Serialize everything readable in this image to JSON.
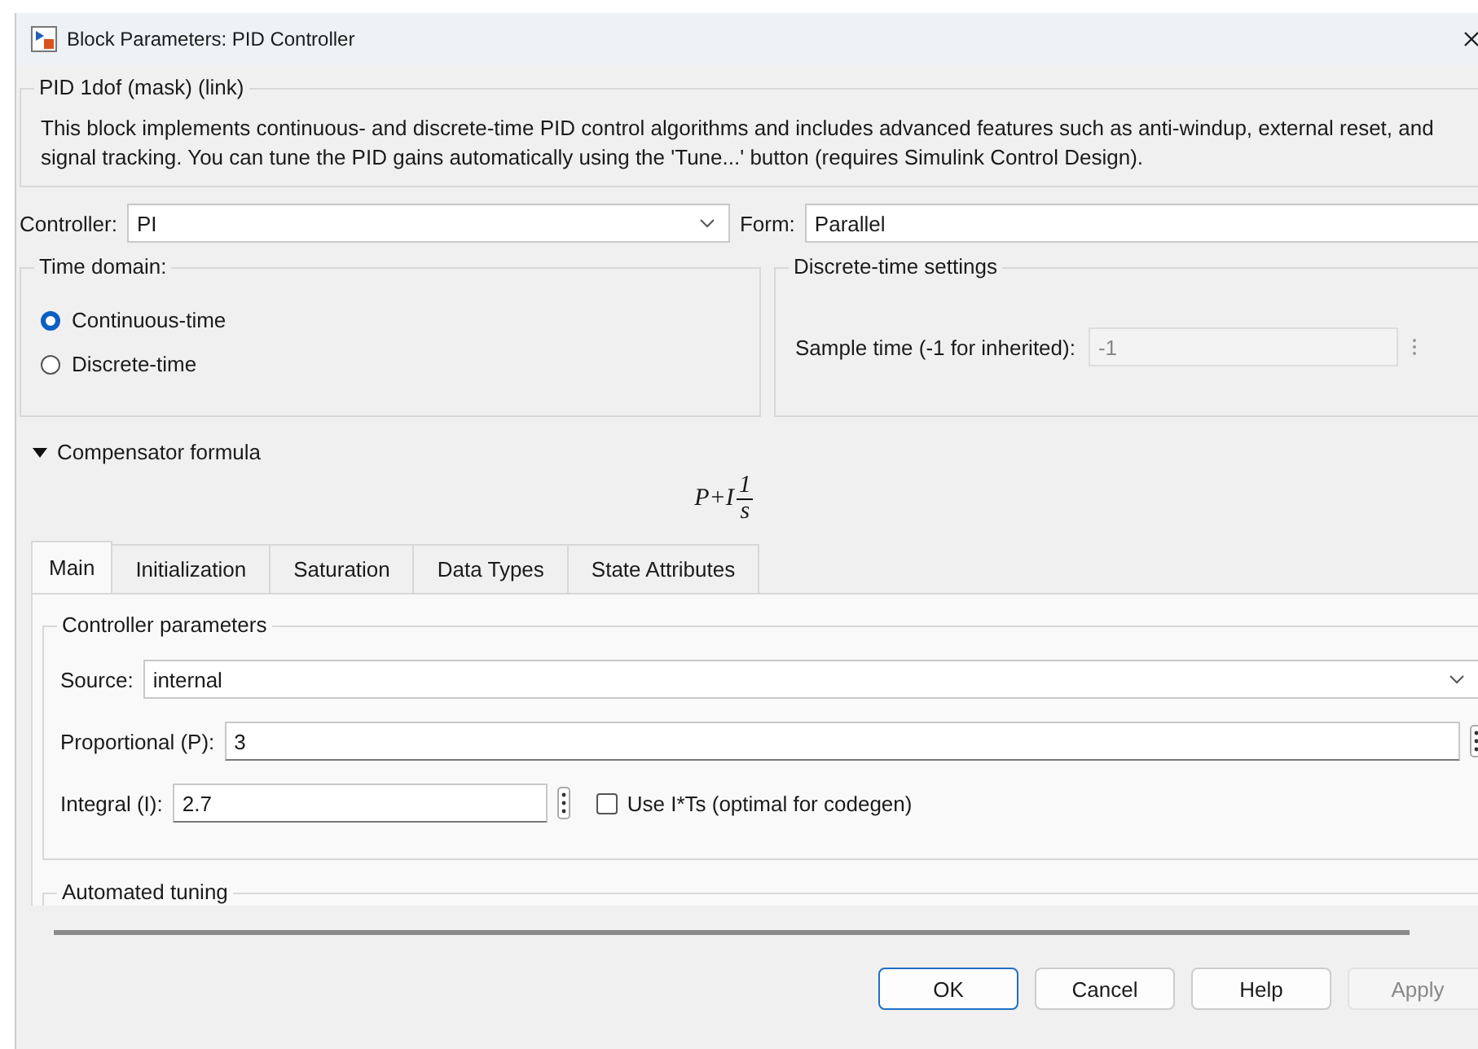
{
  "window": {
    "title": "Block Parameters: PID Controller"
  },
  "mask": {
    "legend": "PID 1dof (mask) (link)",
    "description": "This block implements continuous- and discrete-time PID control algorithms and includes advanced features such as anti-windup, external reset, and signal tracking. You can tune the PID gains automatically using the 'Tune...' button (requires Simulink Control Design)."
  },
  "controller": {
    "label": "Controller:",
    "value": "PI"
  },
  "form": {
    "label": "Form:",
    "value": "Parallel"
  },
  "time_domain": {
    "legend": "Time domain:",
    "options": [
      {
        "label": "Continuous-time",
        "selected": true
      },
      {
        "label": "Discrete-time",
        "selected": false
      }
    ]
  },
  "discrete_settings": {
    "legend": "Discrete-time settings",
    "label": "Sample time (-1 for inherited):",
    "value": "-1",
    "disabled": true
  },
  "compensator": {
    "label": "Compensator formula",
    "expanded": true,
    "formula": {
      "terms": "P+I",
      "numerator": "1",
      "denominator": "s"
    }
  },
  "tabs": [
    {
      "label": "Main",
      "selected": true
    },
    {
      "label": "Initialization",
      "selected": false
    },
    {
      "label": "Saturation",
      "selected": false
    },
    {
      "label": "Data Types",
      "selected": false
    },
    {
      "label": "State Attributes",
      "selected": false
    }
  ],
  "controller_parameters": {
    "legend": "Controller parameters",
    "source": {
      "label": "Source:",
      "value": "internal"
    },
    "proportional": {
      "label": "Proportional (P):",
      "value": "3"
    },
    "integral": {
      "label": "Integral (I):",
      "value": "2.7"
    },
    "use_its": {
      "label": "Use I*Ts (optimal for codegen)",
      "checked": false
    }
  },
  "automated_tuning": {
    "legend": "Automated tuning"
  },
  "buttons": [
    {
      "label": "OK",
      "default": true,
      "disabled": false
    },
    {
      "label": "Cancel",
      "default": false,
      "disabled": false
    },
    {
      "label": "Help",
      "default": false,
      "disabled": false
    },
    {
      "label": "Apply",
      "default": false,
      "disabled": true
    }
  ]
}
